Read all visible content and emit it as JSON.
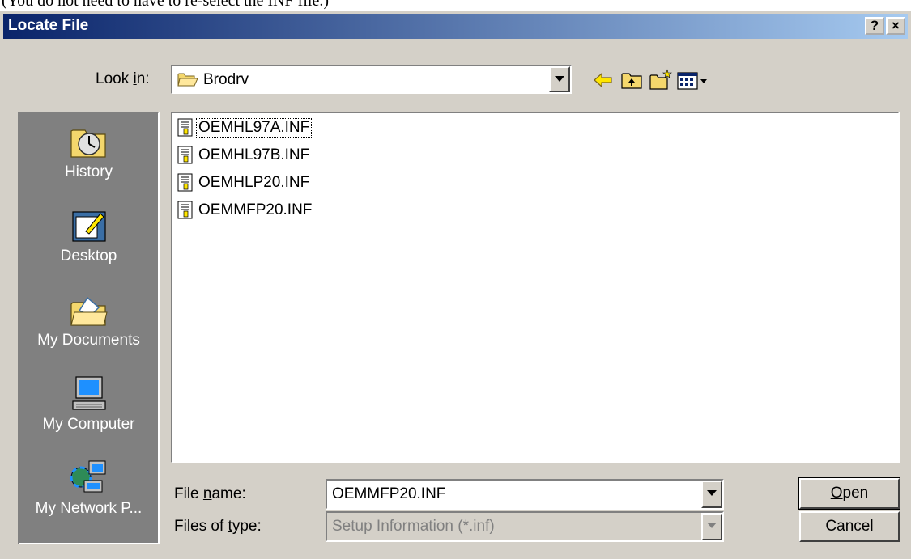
{
  "window": {
    "above_text": "(You do not need to have to re-select the INF file.)",
    "title": "Locate File",
    "help_button": "?",
    "close_button": "×"
  },
  "look_in": {
    "label_pre": "Look ",
    "label_accel": "i",
    "label_post": "n:",
    "value": "Brodrv"
  },
  "toolbar": {
    "icons": [
      "back-arrow-icon",
      "up-one-level-icon",
      "new-folder-icon",
      "view-menu-icon"
    ]
  },
  "places": [
    {
      "label": "History",
      "icon": "history-icon"
    },
    {
      "label": "Desktop",
      "icon": "desktop-icon"
    },
    {
      "label": "My Documents",
      "icon": "my-documents-icon"
    },
    {
      "label": "My Computer",
      "icon": "my-computer-icon"
    },
    {
      "label": "My Network P...",
      "icon": "my-network-places-icon"
    }
  ],
  "files": [
    {
      "name": "OEMHL97A.INF"
    },
    {
      "name": "OEMHL97B.INF"
    },
    {
      "name": "OEMHLP20.INF"
    },
    {
      "name": "OEMMFP20.INF"
    }
  ],
  "file_name": {
    "label_pre": "File ",
    "label_accel": "n",
    "label_post": "ame:",
    "value": "OEMMFP20.INF"
  },
  "file_type": {
    "label_pre": "Files of ",
    "label_accel": "t",
    "label_post": "ype:",
    "value": "Setup Information (*.inf)"
  },
  "buttons": {
    "open_accel": "O",
    "open_rest": "pen",
    "cancel": "Cancel"
  }
}
